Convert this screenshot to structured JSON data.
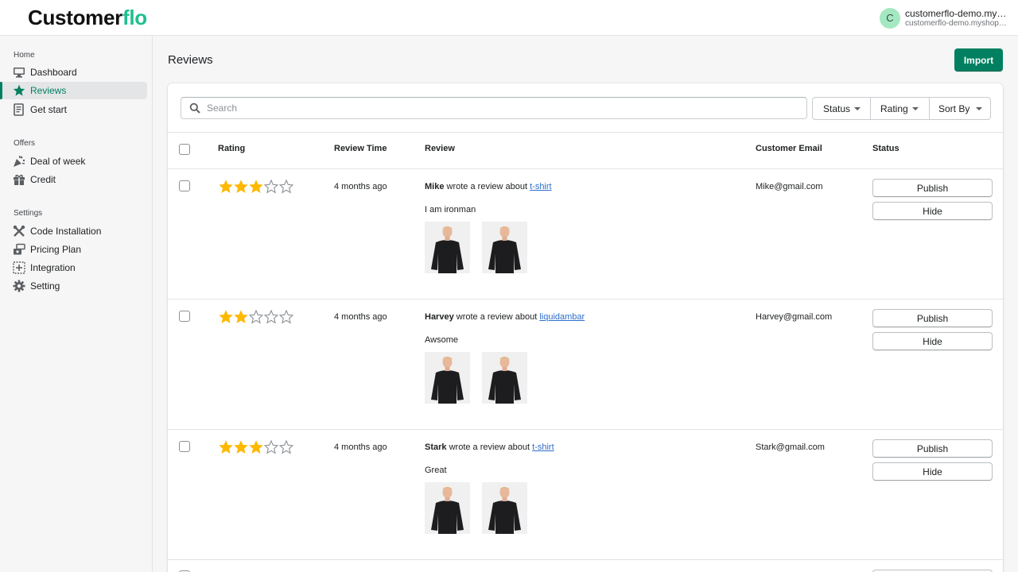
{
  "app": {
    "logo_part1": "Customer",
    "logo_part2": "flo",
    "store_initial": "C",
    "store_name": "customerflo-demo.myshopify.com",
    "store_domain": "customerflo-demo.myshopify.com"
  },
  "sidebar": {
    "sections": [
      {
        "title": "Home",
        "items": [
          {
            "label": "Dashboard",
            "icon": "monitor-icon",
            "active": false
          },
          {
            "label": "Reviews",
            "icon": "star-icon",
            "active": true
          },
          {
            "label": "Get start",
            "icon": "document-icon",
            "active": false
          }
        ]
      },
      {
        "title": "Offers",
        "items": [
          {
            "label": "Deal of week",
            "icon": "confetti-icon",
            "active": false
          },
          {
            "label": "Credit",
            "icon": "gift-icon",
            "active": false
          }
        ]
      },
      {
        "title": "Settings",
        "items": [
          {
            "label": "Code Installation",
            "icon": "tools-icon",
            "active": false
          },
          {
            "label": "Pricing Plan",
            "icon": "price-stack-icon",
            "active": false
          },
          {
            "label": "Integration",
            "icon": "integration-icon",
            "active": false
          },
          {
            "label": "Setting",
            "icon": "gear-icon",
            "active": false
          }
        ]
      }
    ]
  },
  "page": {
    "title": "Reviews",
    "import_label": "Import"
  },
  "toolbar": {
    "search_placeholder": "Search",
    "filters": [
      "Status",
      "Rating",
      "Sort By"
    ]
  },
  "table": {
    "columns": [
      "Rating",
      "Review Time",
      "Review",
      "Customer Email",
      "Status"
    ],
    "publish_label": "Publish",
    "hide_label": "Hide",
    "rows": [
      {
        "rating": 3,
        "max_rating": 5,
        "time": "4 months ago",
        "author": "Mike",
        "action_text": "wrote a review about",
        "product": "t-shirt",
        "text": "I am ironman",
        "email": "Mike@gmail.com",
        "photos": 2
      },
      {
        "rating": 2,
        "max_rating": 5,
        "time": "4 months ago",
        "author": "Harvey",
        "action_text": "wrote a review about",
        "product": "liquidambar",
        "text": "Awsome",
        "email": "Harvey@gmail.com",
        "photos": 2
      },
      {
        "rating": 3,
        "max_rating": 5,
        "time": "4 months ago",
        "author": "Stark",
        "action_text": "wrote a review about",
        "product": "t-shirt",
        "text": "Great",
        "email": "Stark@gmail.com",
        "photos": 2
      }
    ]
  },
  "colors": {
    "primary": "#008060",
    "star_filled": "#ffb800",
    "star_empty": "#8c9196",
    "link": "#2c6ecb"
  }
}
